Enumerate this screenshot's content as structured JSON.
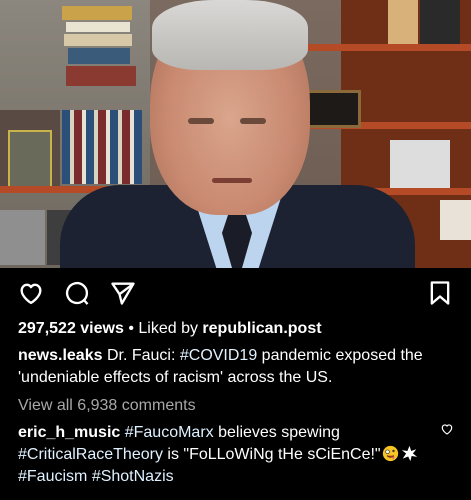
{
  "post": {
    "views_count": "297,522 views",
    "liked_by_prefix": "Liked by",
    "liked_by_user": "republican.post"
  },
  "caption": {
    "username": "news.leaks",
    "text_before_tag": "Dr. Fauci: ",
    "hashtag": "#COVID19",
    "text_after_tag": " pandemic exposed the 'undeniable effects of racism' across the US."
  },
  "comments_link": "View all 6,938 comments",
  "top_comment": {
    "username": "eric_h_music",
    "tag1": "#FaucoMarx",
    "text1": " believes spewing ",
    "tag2": "#CriticalRaceTheory",
    "text2": " is \"FoLLoWiNg tHe sCiEnCe!\"",
    "tag3": "#Faucism",
    "tag4": "#ShotNazis"
  },
  "icons": {
    "like": "heart-icon",
    "comment": "comment-bubble-icon",
    "share": "paper-plane-icon",
    "save": "bookmark-icon",
    "comment_like": "small-heart-icon",
    "emoji1": "zany-face-emoji",
    "emoji2": "collision-emoji"
  },
  "colors": {
    "background": "#000000",
    "text": "#ffffff",
    "muted": "#a8a8a8",
    "hashtag": "#e0f1ff"
  }
}
